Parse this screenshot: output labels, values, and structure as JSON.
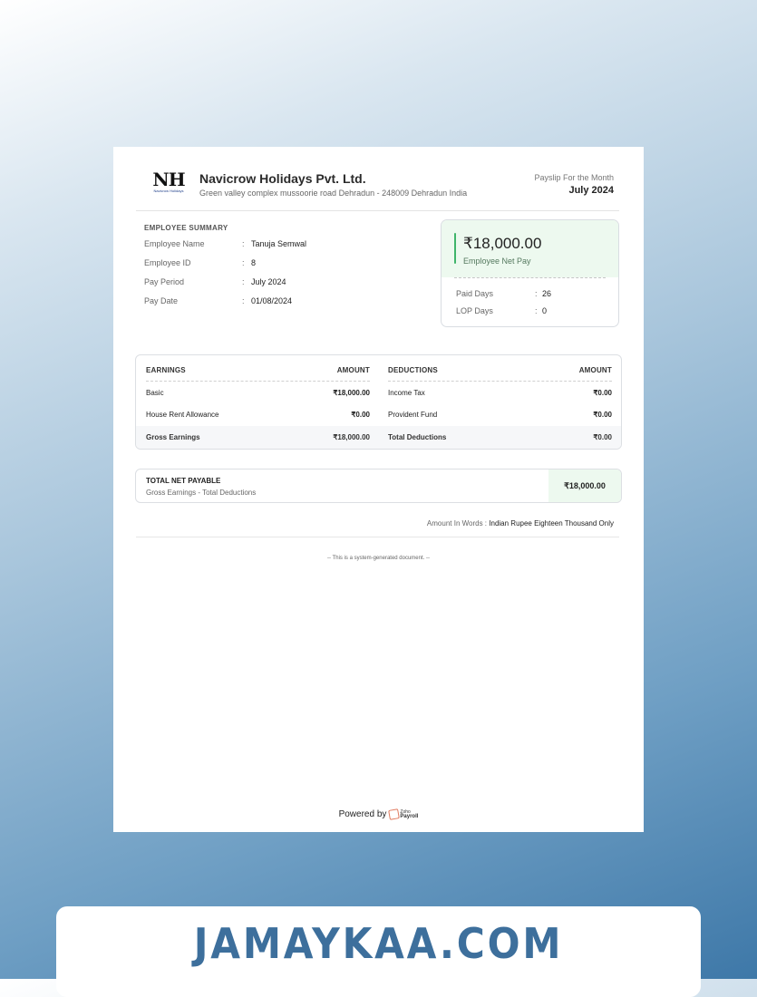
{
  "company": {
    "logo_letters": "NH",
    "logo_sub": "Navicrow Holidays",
    "name": "Navicrow Holidays Pvt. Ltd.",
    "address": "Green valley complex mussoorie road Dehradun - 248009 Dehradun India"
  },
  "payslip": {
    "label": "Payslip For the Month",
    "month": "July 2024"
  },
  "summary": {
    "title": "EMPLOYEE SUMMARY",
    "rows": [
      {
        "label": "Employee Name",
        "value": "Tanuja Semwal"
      },
      {
        "label": "Employee ID",
        "value": "8"
      },
      {
        "label": "Pay Period",
        "value": "July 2024"
      },
      {
        "label": "Pay Date",
        "value": "01/08/2024"
      }
    ]
  },
  "net_card": {
    "amount": "₹18,000.00",
    "label": "Employee Net Pay",
    "days": [
      {
        "label": "Paid Days",
        "value": "26"
      },
      {
        "label": "LOP Days",
        "value": "0"
      }
    ]
  },
  "earnings": {
    "header": "EARNINGS",
    "amount_header": "AMOUNT",
    "rows": [
      {
        "label": "Basic",
        "amount": "₹18,000.00"
      },
      {
        "label": "House Rent Allowance",
        "amount": "₹0.00"
      }
    ],
    "total_label": "Gross Earnings",
    "total_amount": "₹18,000.00"
  },
  "deductions": {
    "header": "DEDUCTIONS",
    "amount_header": "AMOUNT",
    "rows": [
      {
        "label": "Income Tax",
        "amount": "₹0.00"
      },
      {
        "label": "Provident Fund",
        "amount": "₹0.00"
      }
    ],
    "total_label": "Total Deductions",
    "total_amount": "₹0.00"
  },
  "net_payable": {
    "title": "TOTAL NET PAYABLE",
    "subtitle": "Gross Earnings - Total Deductions",
    "amount": "₹18,000.00"
  },
  "words": {
    "label": "Amount In Words :",
    "value": "Indian Rupee Eighteen Thousand Only"
  },
  "footer": {
    "system_note": "-- This is a system-generated document. --",
    "powered_by": "Powered by",
    "brand_top": "Zoho",
    "brand_name": "Payroll"
  },
  "banner": {
    "text": "JAMAYKAA.COM"
  },
  "colors": {
    "net_highlight": "#edf9ef",
    "accent_green": "#3fb56a",
    "banner_text": "#3d6f9c"
  }
}
